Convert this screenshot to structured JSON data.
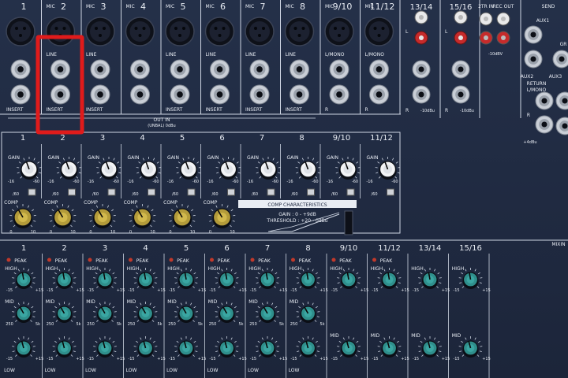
{
  "top_channels": [
    {
      "num": "1",
      "mic": "",
      "line": "",
      "insert": "INSERT"
    },
    {
      "num": "2",
      "mic": "MIC",
      "line": "LINE",
      "insert": "INSERT"
    },
    {
      "num": "3",
      "mic": "MIC",
      "line": "LINE",
      "insert": "INSERT"
    },
    {
      "num": "4",
      "mic": "MIC",
      "line": "",
      "insert": ""
    },
    {
      "num": "5",
      "mic": "MIC",
      "line": "LINE",
      "insert": "INSERT"
    },
    {
      "num": "6",
      "mic": "MIC",
      "line": "LINE",
      "insert": "INSERT"
    },
    {
      "num": "7",
      "mic": "MIC",
      "line": "LINE",
      "insert": "INSERT"
    },
    {
      "num": "8",
      "mic": "MIC",
      "line": "LINE",
      "insert": "INSERT"
    },
    {
      "num": "9/10",
      "mic": "MIC",
      "line": "L/MONO",
      "insert": "R"
    },
    {
      "num": "11/12",
      "mic": "MIC",
      "line": "L/MONO",
      "insert": "R"
    }
  ],
  "stereo_inputs": [
    {
      "num": "13/14",
      "lr_top": "L",
      "lr_bottom": "R",
      "level": "-10dBu"
    },
    {
      "num": "15/16",
      "lr_top": "L",
      "lr_bottom": "R",
      "level": "-10dBu"
    }
  ],
  "two_tr": {
    "in": "2TR IN",
    "out": "REC OUT",
    "level": "-10dBV"
  },
  "aux": {
    "send": "SEND",
    "aux1": "AUX1",
    "aux2": "AUX2",
    "aux3": "AUX3",
    "return": "RETURN",
    "lmono": "L/MONO",
    "r": "R",
    "level": "+4dBu",
    "gr": "GR"
  },
  "out_in": {
    "line1": "OUT    IN",
    "line2": "(UNBAL) 0dBu"
  },
  "gain_section": {
    "channels": [
      "1",
      "2",
      "3",
      "4",
      "5",
      "6",
      "7",
      "8",
      "9/10",
      "11/12"
    ],
    "gain_label": "GAIN",
    "scale_left": "-16",
    "scale_right": "-60",
    "pad_label": "/60",
    "comp_label": "COMP",
    "comp_scale_left": "0",
    "comp_scale_right": "10"
  },
  "comp_char": {
    "title": "COMP CHARACTERISTICS",
    "line1": "GAIN : 0 - +9dB",
    "line2": "THRESHOLD : +20 - 0dBu"
  },
  "eq_section": {
    "channels": [
      "1",
      "2",
      "3",
      "4",
      "5",
      "6",
      "7",
      "8",
      "9/10",
      "11/12",
      "13/14",
      "15/16"
    ],
    "peak": "PEAK",
    "high": "HIGH",
    "mid": "MID",
    "low": "LOW",
    "scale_left": "-15",
    "scale_right": "+15",
    "mid_left": "250",
    "mid_right": "5k"
  },
  "misc": {
    "mixing": "MIXIN"
  },
  "colors": {
    "panel": "#1f2940",
    "line": "#cfd6e3",
    "knob_teal": "#2f8f8c",
    "knob_gold": "#b39b3a",
    "highlight": "#e01b1b"
  }
}
